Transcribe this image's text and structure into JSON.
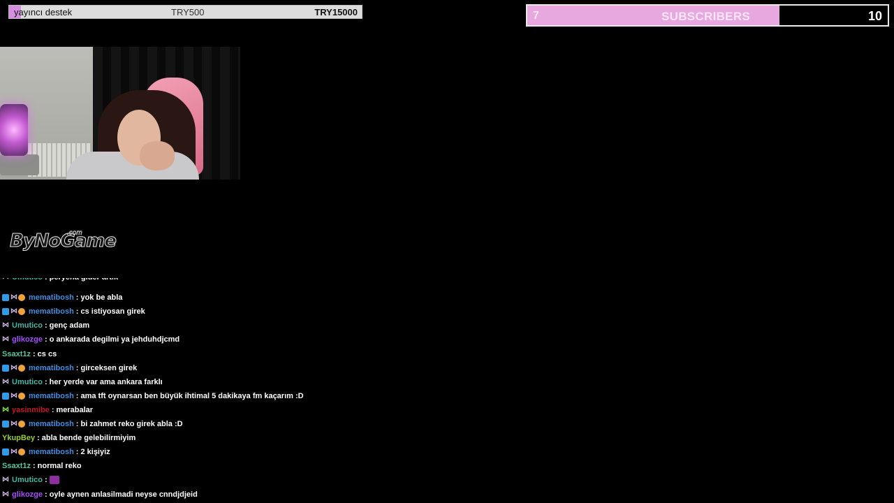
{
  "goal": {
    "name": "yayıncı destek",
    "current": "TRY500",
    "target": "TRY15000",
    "progress": 0.033,
    "fill_color": "#d58ee0"
  },
  "subs": {
    "current": "7",
    "label": "SUBSCRIBERS",
    "goal": "10",
    "progress": 0.7,
    "fill_color": "#e6a8df"
  },
  "logo": {
    "text": "ByNoGame",
    "suffix": ".com"
  },
  "chat": {
    "colors": {
      "memati": "#3e8fe0",
      "umutico": "#3fb9a6",
      "glikozge": "#a64cff",
      "ssaxt": "#55c7a0",
      "yasin": "#c0152a",
      "ykup": "#9acd32"
    },
    "messages": [
      {
        "badges": [
          "sub"
        ],
        "user": "Umutico",
        "text": "peryena gider artik",
        "color": "#3fb9a6"
      },
      {
        "badges": [
          "prime",
          "sub",
          "bits"
        ],
        "user": "mematibosh",
        "text": "yok be abla",
        "color": "#3e8fe0"
      },
      {
        "badges": [
          "prime",
          "sub",
          "bits"
        ],
        "user": "mematibosh",
        "text": "cs istiyosan girek",
        "color": "#3e8fe0"
      },
      {
        "badges": [
          "sub"
        ],
        "user": "Umutico",
        "text": "genç adam",
        "color": "#3fb9a6"
      },
      {
        "badges": [
          "sub"
        ],
        "user": "glikozge",
        "text": "o ankarada degilmi ya jehduhdjcmd",
        "color": "#a64cff"
      },
      {
        "badges": [],
        "user": "Ssaxt1z",
        "text": "cs cs",
        "color": "#55c7a0"
      },
      {
        "badges": [
          "prime",
          "sub",
          "bits"
        ],
        "user": "mematibosh",
        "text": "girceksen girek",
        "color": "#3e8fe0"
      },
      {
        "badges": [
          "sub"
        ],
        "user": "Umutico",
        "text": "her yerde var ama ankara farklı",
        "color": "#3fb9a6"
      },
      {
        "badges": [
          "prime",
          "sub",
          "bits"
        ],
        "user": "mematibosh",
        "text": "ama tft oynarsan ben büyük ihtimal 5 dakikaya fm kaçarım :D",
        "color": "#3e8fe0"
      },
      {
        "badges": [
          "sub-green"
        ],
        "user": "yasinmibe",
        "text": "merabalar",
        "color": "#c0152a"
      },
      {
        "badges": [
          "prime",
          "sub",
          "bits"
        ],
        "user": "mematibosh",
        "text": "bi zahmet reko girek abla :D",
        "color": "#3e8fe0"
      },
      {
        "badges": [],
        "user": "YkupBey",
        "text": "abla bende gelebilirmiyim",
        "color": "#9acd32"
      },
      {
        "badges": [
          "prime",
          "sub",
          "bits"
        ],
        "user": "mematibosh",
        "text": "2 kişiyiz",
        "color": "#3e8fe0"
      },
      {
        "badges": [],
        "user": "Ssaxt1z",
        "text": "normal reko",
        "color": "#55c7a0"
      },
      {
        "badges": [
          "sub"
        ],
        "user": "Umutico",
        "text": "",
        "emote": "purple-emote",
        "color": "#3fb9a6"
      },
      {
        "badges": [
          "sub"
        ],
        "user": "glikozge",
        "text": "oyle aynen anlasilmadi neyse cnndjdjeid",
        "color": "#a64cff"
      }
    ]
  }
}
